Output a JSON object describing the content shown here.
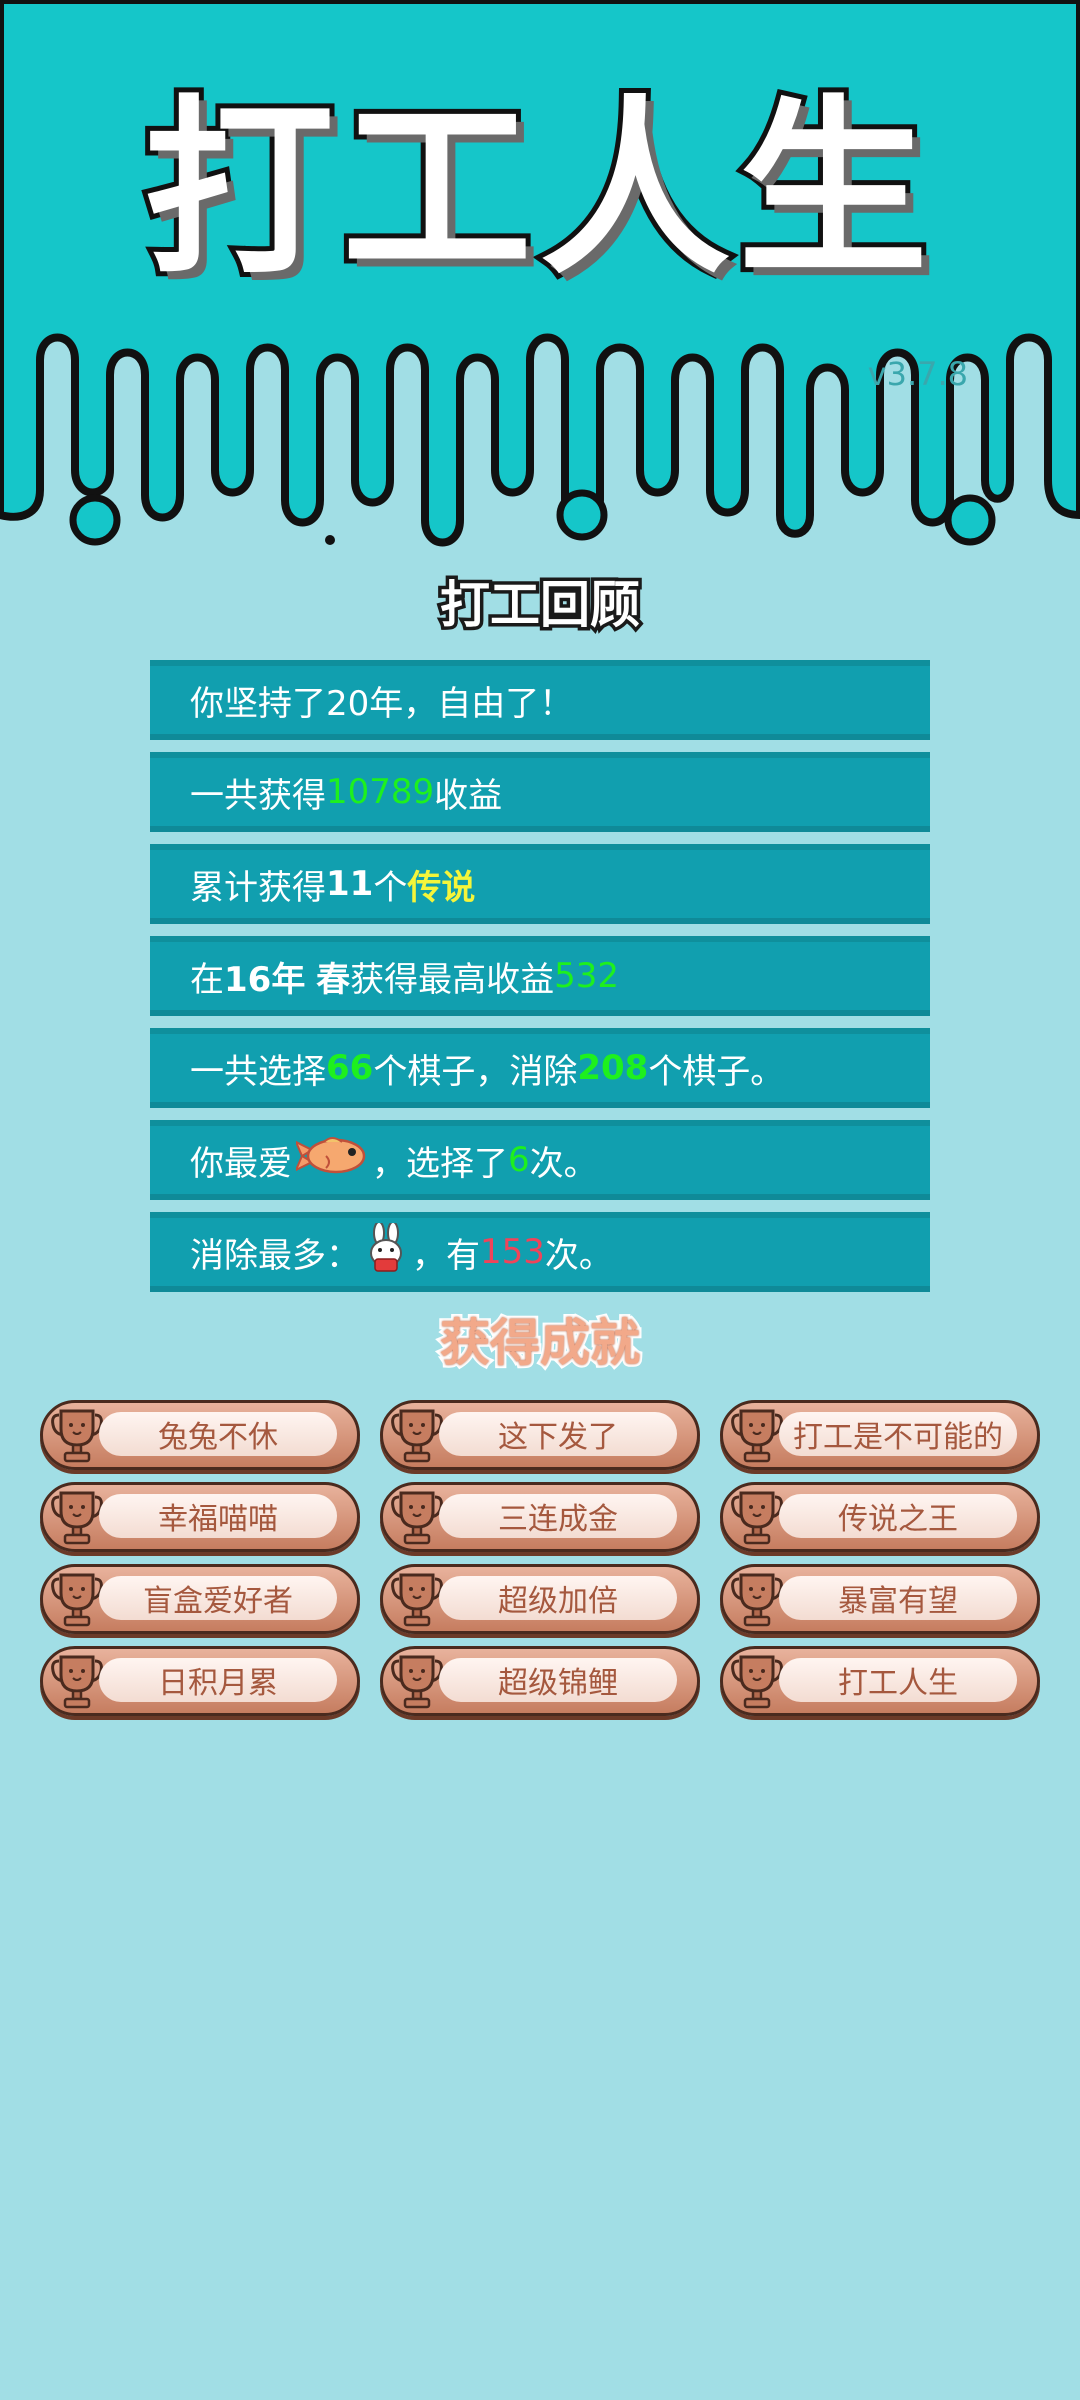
{
  "app": {
    "title": "打工人生",
    "version": "v3.7.8"
  },
  "colors": {
    "teal_header": "#15c6c9",
    "page_bg": "#a1dee5",
    "row_bg": "#119faf",
    "green": "#1ef01e",
    "yellow": "#f5f53a",
    "red": "#f0445a"
  },
  "review": {
    "title": "打工回顾",
    "rows": [
      {
        "text": "你坚持了20年，自由了！"
      },
      {
        "prefix": "一共获得",
        "value": "10789",
        "suffix": "收益"
      },
      {
        "prefix": "累计获得",
        "count": "11",
        "mid": "个",
        "highlight": "传说"
      },
      {
        "prefix": "在 ",
        "year": "16年",
        "season": "春",
        "mid": " 获得最高收益",
        "value": "532"
      },
      {
        "prefix": "一共选择",
        "chosen": "66",
        "mid": "个棋子，消除",
        "removed": "208",
        "suffix": "个棋子。"
      },
      {
        "prefix": "你最爱",
        "icon": "fish-icon",
        "mid": "，选择了",
        "value": "6",
        "suffix": "次。"
      },
      {
        "prefix": "消除最多：",
        "icon": "rabbit-icon",
        "mid": "，有",
        "value": "153",
        "suffix": "次。"
      }
    ]
  },
  "achievements": {
    "title": "获得成就",
    "icon": "trophy-icon",
    "items": [
      "兔兔不休",
      "这下发了",
      "打工是不可能的",
      "幸福喵喵",
      "三连成金",
      "传说之王",
      "盲盒爱好者",
      "超级加倍",
      "暴富有望",
      "日积月累",
      "超级锦鲤",
      "打工人生"
    ]
  }
}
